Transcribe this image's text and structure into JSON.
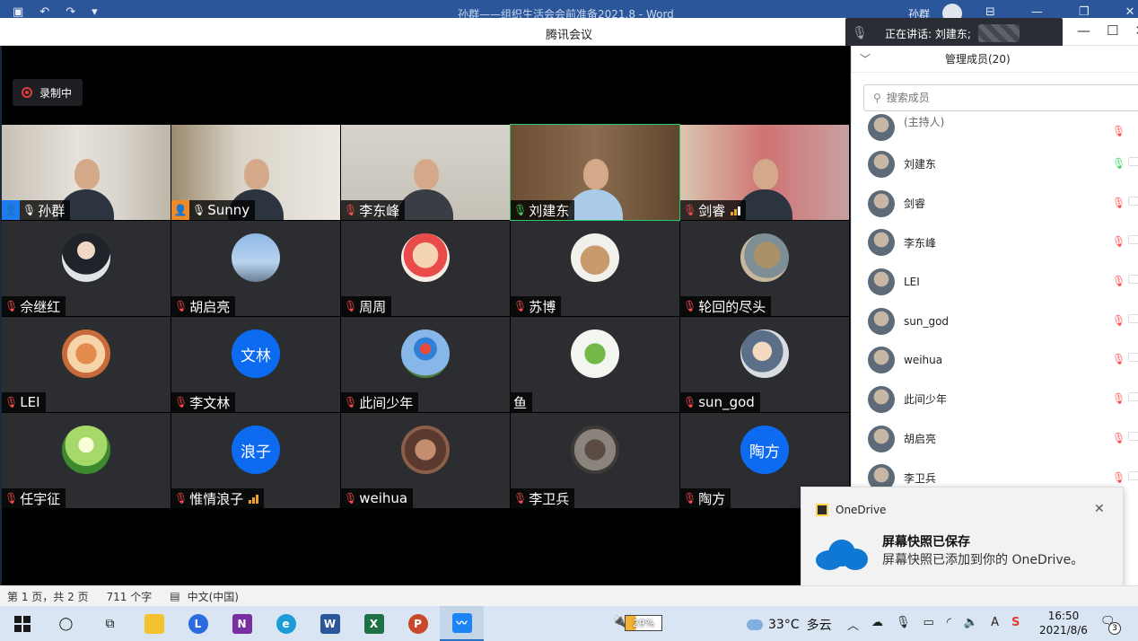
{
  "word": {
    "title": "孙群——组织生活会会前准备2021.8 - Word",
    "user": "孙群",
    "status": {
      "page": "第 1 页，共 2 页",
      "words": "711 个字",
      "lang": "中文(中国)"
    }
  },
  "meeting": {
    "title": "腾讯会议",
    "speaking": "正在讲话: 刘建东;",
    "recording": "录制中",
    "tiles": [
      {
        "name": "孙群",
        "host": true,
        "host_color": "#1e7cf2",
        "mic": "on"
      },
      {
        "name": "Sunny",
        "host": true,
        "host_color": "#f08a24",
        "mic": "on"
      },
      {
        "name": "李东峰",
        "mic": "muted"
      },
      {
        "name": "刘建东",
        "mic": "green"
      },
      {
        "name": "剑睿",
        "mic": "muted",
        "signal": true
      },
      {
        "name": "佘继红",
        "mic": "muted"
      },
      {
        "name": "胡启亮",
        "mic": "muted"
      },
      {
        "name": "周周",
        "mic": "muted"
      },
      {
        "name": "苏博",
        "mic": "muted"
      },
      {
        "name": "轮回的尽头",
        "mic": "muted"
      },
      {
        "name": "LEI",
        "mic": "muted"
      },
      {
        "name": "李文林",
        "avatar_text": "文林",
        "mic": "muted"
      },
      {
        "name": "此间少年",
        "mic": "muted"
      },
      {
        "name": "鱼",
        "mic": "none"
      },
      {
        "name": "sun_god",
        "mic": "muted"
      },
      {
        "name": "任宇征",
        "mic": "muted"
      },
      {
        "name": "惟情浪子",
        "avatar_text": "浪子",
        "mic": "muted",
        "signal": true
      },
      {
        "name": "weihua",
        "mic": "muted"
      },
      {
        "name": "李卫兵",
        "mic": "muted"
      },
      {
        "name": "陶方",
        "avatar_text": "陶方",
        "mic": "muted"
      }
    ]
  },
  "members": {
    "title": "管理成员(20)",
    "search_placeholder": "搜索成员",
    "host_label": "(主持人)",
    "list": [
      "刘建东",
      "剑睿",
      "李东峰",
      "LEI",
      "sun_god",
      "weihua",
      "此间少年",
      "胡启亮",
      "李卫兵"
    ]
  },
  "toast": {
    "app": "OneDrive",
    "title": "屏幕快照已保存",
    "message": "屏幕快照已添加到你的 OneDrive。"
  },
  "taskbar": {
    "battery": "29%",
    "temperature": "33°C",
    "weather": "多云",
    "time": "16:50",
    "date": "2021/8/6",
    "notifications": "3"
  }
}
